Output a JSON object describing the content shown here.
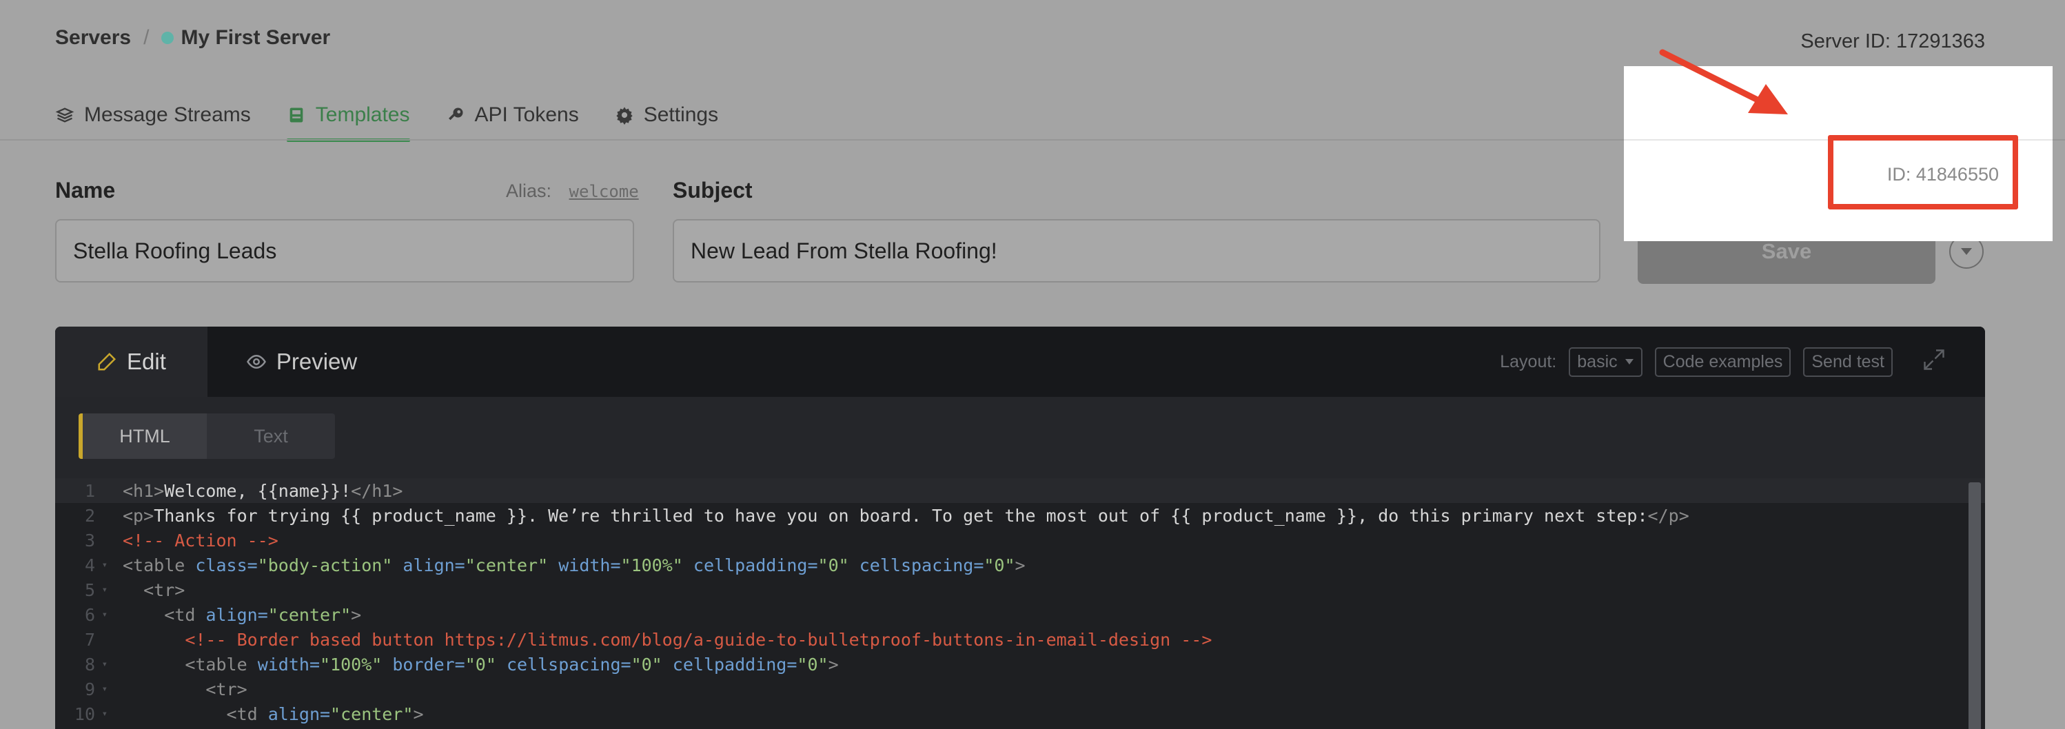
{
  "breadcrumb": {
    "root": "Servers",
    "separator": "/",
    "server_name": "My First Server"
  },
  "server_id": {
    "label": "Server ID:",
    "value": "17291363"
  },
  "nav": {
    "message_streams": "Message Streams",
    "templates": "Templates",
    "api_tokens": "API Tokens",
    "settings": "Settings"
  },
  "form": {
    "name_label": "Name",
    "alias_label": "Alias:",
    "alias_value": "welcome",
    "name_value": "Stella Roofing Leads",
    "subject_label": "Subject",
    "subject_value": "New Lead From Stella Roofing!",
    "save_label": "Save",
    "template_id": "ID: 41846550"
  },
  "editor": {
    "tab_edit": "Edit",
    "tab_preview": "Preview",
    "layout_label": "Layout:",
    "layout_value": "basic",
    "code_examples": "Code examples",
    "send_test": "Send test",
    "subtab_html": "HTML",
    "subtab_text": "Text",
    "lines": {
      "l1_tag_open": "<h1>",
      "l1_text": "Welcome, {{name}}!",
      "l1_tag_close": "</h1>",
      "l2_tag_open": "<p>",
      "l2_text": "Thanks for trying {{ product_name }}. We’re thrilled to have you on board. To get the most out of {{ product_name }}, do this primary next step:",
      "l2_tag_close": "</p>",
      "l3": "<!-- Action -->",
      "l4_tag": "<table",
      "l4_a1": "class=",
      "l4_v1": "\"body-action\"",
      "l4_a2": "align=",
      "l4_v2": "\"center\"",
      "l4_a3": "width=",
      "l4_v3": "\"100%\"",
      "l4_a4": "cellpadding=",
      "l4_v4": "\"0\"",
      "l4_a5": "cellspacing=",
      "l4_v5": "\"0\"",
      "l4_end": ">",
      "l5": "<tr>",
      "l6_tag": "<td",
      "l6_a1": "align=",
      "l6_v1": "\"center\"",
      "l6_end": ">",
      "l7": "<!-- Border based button https://litmus.com/blog/a-guide-to-bulletproof-buttons-in-email-design -->",
      "l8_tag": "<table",
      "l8_a1": "width=",
      "l8_v1": "\"100%\"",
      "l8_a2": "border=",
      "l8_v2": "\"0\"",
      "l8_a3": "cellspacing=",
      "l8_v3": "\"0\"",
      "l8_a4": "cellpadding=",
      "l8_v4": "\"0\"",
      "l8_end": ">",
      "l9": "<tr>",
      "l10_tag": "<td",
      "l10_a1": "align=",
      "l10_v1": "\"center\"",
      "l10_end": ">"
    },
    "line_numbers": [
      "1",
      "2",
      "3",
      "4",
      "5",
      "6",
      "7",
      "8",
      "9",
      "10"
    ]
  },
  "colors": {
    "accent_green": "#3b8a4f",
    "highlight_red": "#e8412c",
    "server_dot": "#5fb3a8"
  },
  "icons": [
    "stack-icon",
    "template-icon",
    "key-icon",
    "gear-icon",
    "pencil-icon",
    "eye-icon",
    "expand-icon",
    "chevron-down-icon",
    "arrow-annotation-icon"
  ]
}
